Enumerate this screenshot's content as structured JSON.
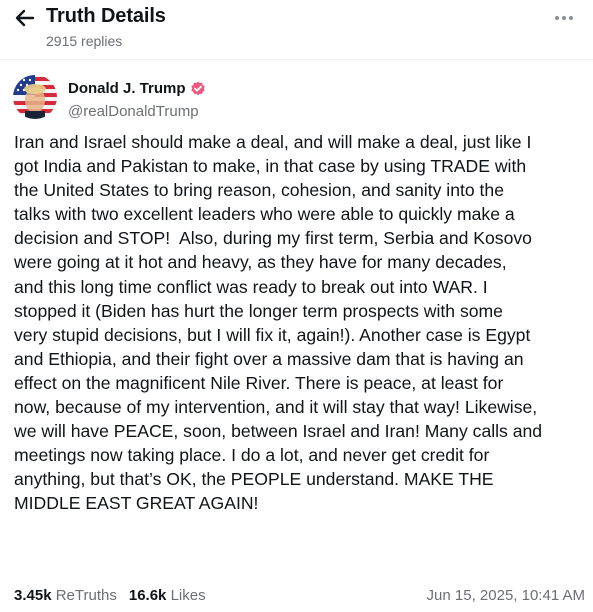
{
  "header": {
    "title": "Truth Details",
    "replies": "2915 replies",
    "back_icon": "arrow-left-icon",
    "more_icon": "more-horizontal-icon"
  },
  "post": {
    "author_name": "Donald J. Trump",
    "handle": "@realDonaldTrump",
    "verified_color": "#e85a7f",
    "body": "Iran and Israel should make a deal, and will make a deal, just like I\ngot India and Pakistan to make, in that case by using TRADE with\nthe United States to bring reason, cohesion, and sanity into the\ntalks with two excellent leaders who were able to quickly make a\ndecision and STOP!  Also, during my first term, Serbia and Kosovo\nwere going at it hot and heavy, as they have for many decades,\nand this long time conflict was ready to break out into WAR. I\nstopped it (Biden has hurt the longer term prospects with some\nvery stupid decisions, but I will fix it, again!). Another case is Egypt\nand Ethiopia, and their fight over a massive dam that is having an\neffect on the magnificent Nile River. There is peace, at least for\nnow, because of my intervention, and it will stay that way! Likewise,\nwe will have PEACE, soon, between Israel and Iran! Many calls and\nmeetings now taking place. I do a lot, and never get credit for\nanything, but that’s OK, the PEOPLE understand. MAKE THE\nMIDDLE EAST GREAT AGAIN!",
    "retruths_count": "3.45k",
    "retruths_label": "ReTruths",
    "likes_count": "16.6k",
    "likes_label": "Likes",
    "timestamp": "Jun 15, 2025, 10:41 AM"
  }
}
